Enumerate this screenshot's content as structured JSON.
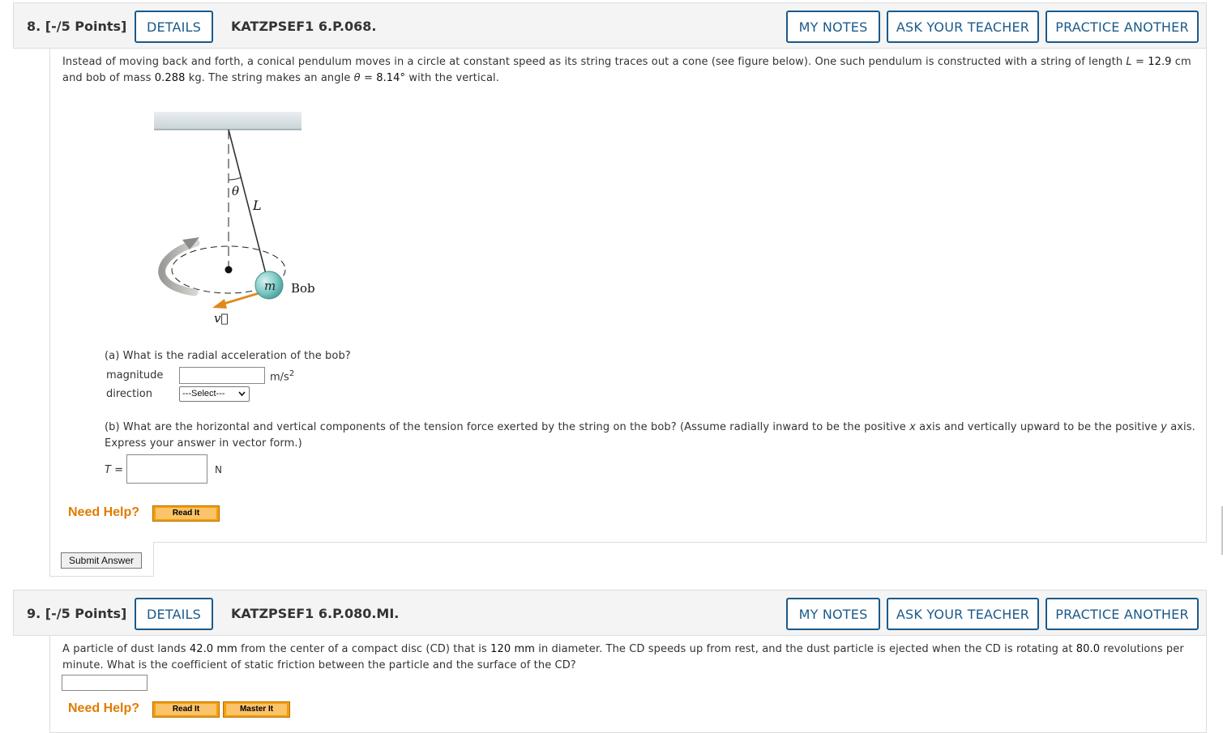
{
  "q8": {
    "number": "8.  [-/5 Points]",
    "details": "DETAILS",
    "code": "KATZPSEF1 6.P.068.",
    "my_notes": "MY NOTES",
    "ask_teacher": "ASK YOUR TEACHER",
    "practice": "PRACTICE ANOTHER",
    "intro_1": "Instead of moving back and forth, a conical pendulum moves in a circle at constant speed as its string traces out a cone (see figure below). One such pendulum is constructed with a string of length ",
    "L_sym": "L",
    "eq": " = ",
    "L_val": "12.9",
    "L_unit": " cm",
    "intro_2": "and bob of mass ",
    "m_val": "0.288",
    "intro_3": " kg. The string makes an angle ",
    "theta_sym": "θ",
    "theta_val": "8.14°",
    "intro_4": " with the vertical.",
    "figure": {
      "theta": "θ",
      "L": "L",
      "m": "m",
      "bob": "Bob",
      "v": "v⃗"
    },
    "part_a": "(a) What is the radial acceleration of the bob?",
    "magnitude_label": "magnitude",
    "unit_a": "m/s",
    "unit_a_exp": "2",
    "direction_label": "direction",
    "select_value": "---Select---",
    "part_b_1": "(b) What are the horizontal and vertical components of the tension force exerted by the string on the bob? (Assume radially inward to be the positive ",
    "x": "x",
    "part_b_2": " axis and vertically upward to be the positive ",
    "y": "y",
    "part_b_3": " axis.",
    "part_b_4": "Express your answer in vector form.)",
    "T_label": "T =",
    "unit_b": "N",
    "need_help": "Need Help?",
    "read_it": "Read It",
    "submit": "Submit Answer"
  },
  "q9": {
    "number": "9.  [-/5 Points]",
    "details": "DETAILS",
    "code": "KATZPSEF1 6.P.080.MI.",
    "my_notes": "MY NOTES",
    "ask_teacher": "ASK YOUR TEACHER",
    "practice": "PRACTICE ANOTHER",
    "text_1": "A particle of dust lands ",
    "d_val": "42.0 mm",
    "text_2": " from the center of a compact disc (CD) that is ",
    "D_val": "120 mm",
    "text_3": " in diameter. The CD speeds up from rest, and the dust particle is ejected when the CD is rotating at ",
    "rpm_val": "80.0",
    "text_4": " revolutions per",
    "text_5": "minute. What is the coefficient of static friction between the particle and the surface of the CD?",
    "need_help": "Need Help?",
    "read_it": "Read It",
    "master_it": "Master It"
  }
}
